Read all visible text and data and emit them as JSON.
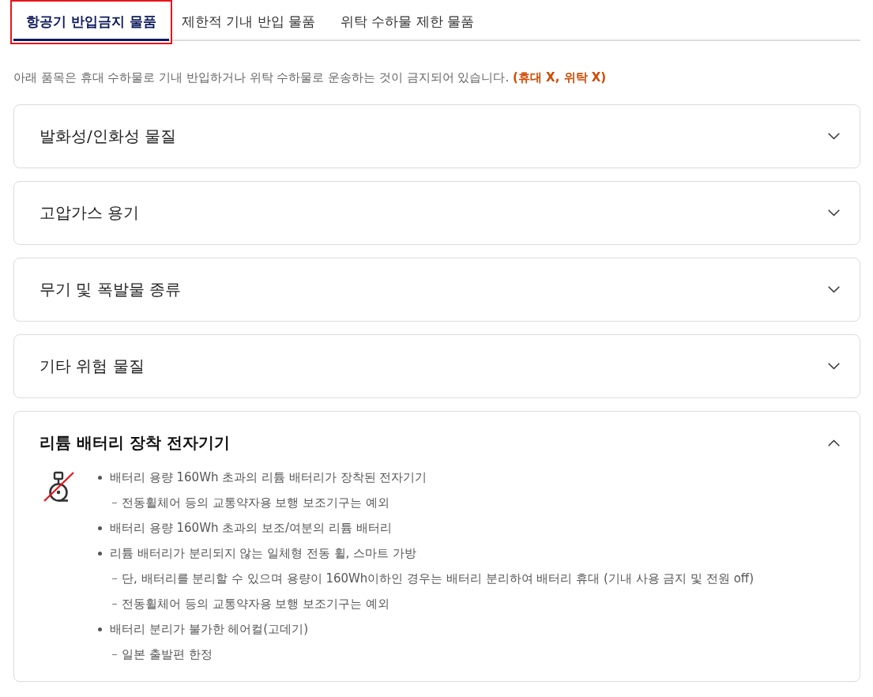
{
  "tabs": [
    {
      "label": "항공기 반입금지 물품",
      "selected": true,
      "highlighted": true
    },
    {
      "label": "제한적 기내 반입 물품",
      "selected": false,
      "highlighted": false
    },
    {
      "label": "위탁 수하물 제한 물품",
      "selected": false,
      "highlighted": false
    }
  ],
  "intro": "아래 품목은 휴대 수하물로 기내 반입하거나 위탁 수하물로 운송하는 것이 금지되어 있습니다. **(휴대 X, 위탁 X)**",
  "sections": [
    {
      "title": "발화성/인화성 물질",
      "expanded": false
    },
    {
      "title": "고압가스 용기",
      "expanded": false
    },
    {
      "title": "무기 및 폭발물 종류",
      "expanded": false
    },
    {
      "title": "기타 위험 물질",
      "expanded": false
    },
    {
      "title": "리튬 배터리 장착 전자기기",
      "expanded": true,
      "items": [
        {
          "text": "배터리 용량 160Wh 초과의 리튬 배터리가 장착된 전자기기",
          "children": [
            {
              "text": "전동휠체어 등의 교통약자용 보행 보조기구는 예외"
            }
          ]
        },
        {
          "text": "배터리 용량 160Wh 초과의 보조/여분의 리튬 배터리"
        },
        {
          "text": "리튬 배터리가 분리되지 않는 일체형 전동 휠, 스마트 가방",
          "children": [
            {
              "text": "단, 배터리를 분리할 수 있으며 용량이 160Wh이하인 경우는 배터리 분리하여 배터리 휴대 (기내 사용 금지 및 전원 off)"
            },
            {
              "text": "전동휠체어 등의 교통약자용 보행 보조기구는 예외"
            }
          ]
        },
        {
          "text": "배터리 분리가 불가한 헤어컬(고데기)",
          "children": [
            {
              "text": "일본 출발편 한정"
            }
          ]
        }
      ]
    }
  ]
}
